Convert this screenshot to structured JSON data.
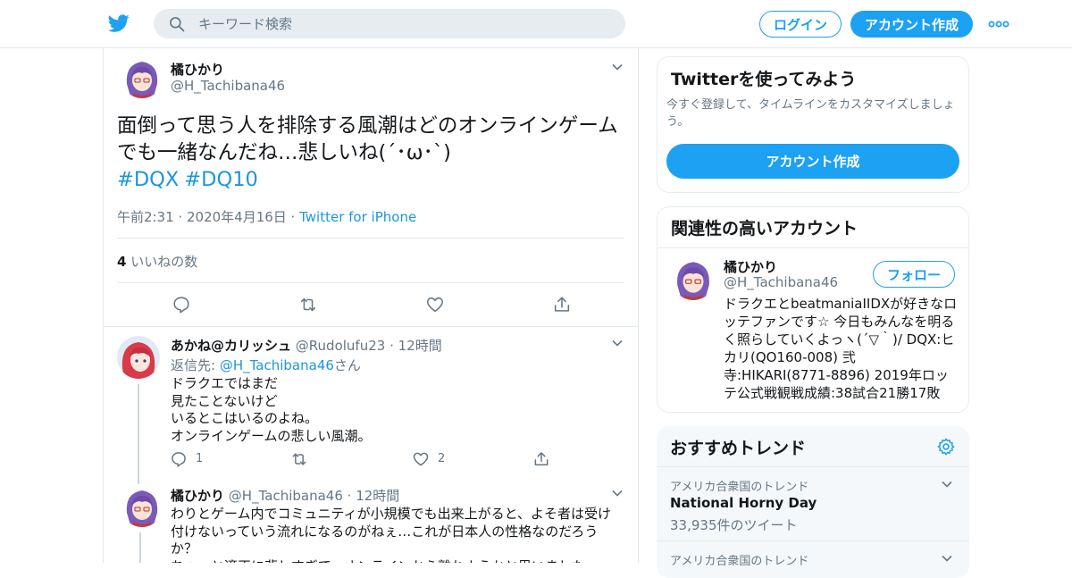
{
  "header": {
    "search_placeholder": "キーワード検索",
    "login_label": "ログイン",
    "signup_label": "アカウント作成"
  },
  "tweet": {
    "author_name": "橘ひかり",
    "author_handle": "@H_Tachibana46",
    "text": "面倒って思う人を排除する風潮はどのオンラインゲームでも一緒なんだね…悲しいね(´･ω･`)",
    "hashtags": [
      "#DQX",
      "#DQ10"
    ],
    "timestamp": "午前2:31 · 2020年4月16日 · ",
    "source": "Twitter for iPhone",
    "likes_count": "4",
    "likes_label": " いいねの数"
  },
  "replies": [
    {
      "name": "あかね@カリッシュ",
      "handle": "@Rudolufu23",
      "time": "· 12時間",
      "reply_prefix": "返信先: ",
      "reply_mention": "@H_Tachibana46",
      "reply_suffix": "さん",
      "body": "ドラクエではまだ\n見たことないけど\nいるとこはいるのよね。\nオンラインゲームの悲しい風潮。",
      "reply_count": "1",
      "retweet_count": "",
      "like_count": "2"
    },
    {
      "name": "橘ひかり",
      "handle": "@H_Tachibana46",
      "time": "· 12時間",
      "body": "わりとゲーム内でコミュニティが小規模でも出来上がると、よそ者は受け付けないっていう流れになるのがねぇ…これが日本人の性格なのだろうか？\nちょっと適正に悲しすぎて、オンラインから離れようかと思いました"
    }
  ],
  "sidebar": {
    "signup_card": {
      "title": "Twitterを使ってみよう",
      "subtitle": "今すぐ登録して、タイムラインをカスタマイズしましょう。",
      "button": "アカウント作成"
    },
    "related_card": {
      "title": "関連性の高いアカウント",
      "name": "橘ひかり",
      "handle": "@H_Tachibana46",
      "follow_label": "フォロー",
      "bio": "ドラクエとbeatmaniaIIDXが好きなロッテファンです☆ 今日もみんなを明るく照らしていくよっヽ(´▽｀)/ DQX:ヒカリ(QO160-008) 弐寺:HIKARI(8771-8896) 2019年ロッテ公式戦観戦成績:38試合21勝17敗"
    },
    "trends_card": {
      "title": "おすすめトレンド",
      "trends": [
        {
          "location": "アメリカ合衆国のトレンド",
          "name": "National Horny Day",
          "count": "33,935件のツイート"
        },
        {
          "location": "アメリカ合衆国のトレンド",
          "name": "",
          "count": ""
        }
      ]
    }
  },
  "colors": {
    "accent": "#1da1f2",
    "link": "#1b95e0",
    "secondary_text": "#657786",
    "border": "#e1e8ed"
  }
}
